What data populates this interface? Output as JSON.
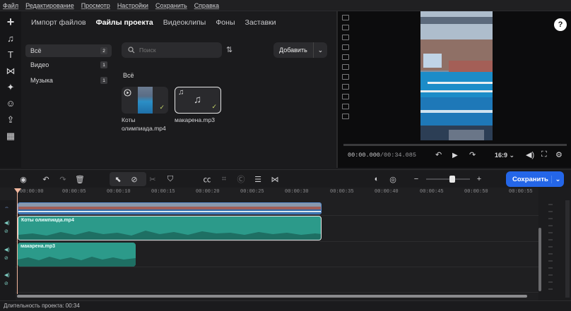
{
  "menu": [
    "Файл",
    "Редактирование",
    "Просмотр",
    "Настройки",
    "Сохранить",
    "Справка"
  ],
  "left_tools": [
    {
      "name": "add-icon",
      "glyph": "+"
    },
    {
      "name": "music-icon",
      "glyph": "♫"
    },
    {
      "name": "text-icon",
      "glyph": "T"
    },
    {
      "name": "transitions-icon",
      "glyph": "⋈"
    },
    {
      "name": "effects-icon",
      "glyph": "✦"
    },
    {
      "name": "stickers-icon",
      "glyph": "☺"
    },
    {
      "name": "export-icon",
      "glyph": "⇪"
    },
    {
      "name": "more-tools-icon",
      "glyph": "▦"
    }
  ],
  "library": {
    "tabs": [
      "Импорт файлов",
      "Файлы проекта",
      "Видеоклипы",
      "Фоны",
      "Заставки"
    ],
    "active_tab": "Файлы проекта",
    "categories": [
      {
        "label": "Всё",
        "count": "2"
      },
      {
        "label": "Видео",
        "count": "1"
      },
      {
        "label": "Музыка",
        "count": "1"
      }
    ],
    "search_placeholder": "Поиск",
    "add_button": "Добавить",
    "section_title": "Всё",
    "files": [
      {
        "name": "Коты олимпиада.mp4",
        "caption_line1": "Коты",
        "caption_line2": "олимпиада.mp4",
        "type": "video"
      },
      {
        "name": "макарена.mp3",
        "caption_line1": "макарена.mp3",
        "type": "audio"
      }
    ]
  },
  "preview": {
    "help": "?",
    "current_time": "00:00.000",
    "total_time": "00:34.085",
    "aspect": "16:9",
    "accent": "#2466e8"
  },
  "timeline_toolbar": {
    "save_button": "Сохранить"
  },
  "ruler_labels": [
    "00:00:00",
    "00:00:05",
    "00:00:10",
    "00:00:15",
    "00:00:20",
    "00:00:25",
    "00:00:30",
    "00:00:35",
    "00:00:40",
    "00:00:45",
    "00:00:50",
    "00:00:55"
  ],
  "tracks": {
    "video_clip_name": "Коты олимпиада.mp4",
    "audio_clip_1_name": "Коты олимпиада.mp4",
    "audio_clip_2_name": "макарена.mp3"
  },
  "status": {
    "duration_text": "Длительность проекта: 00:34"
  }
}
